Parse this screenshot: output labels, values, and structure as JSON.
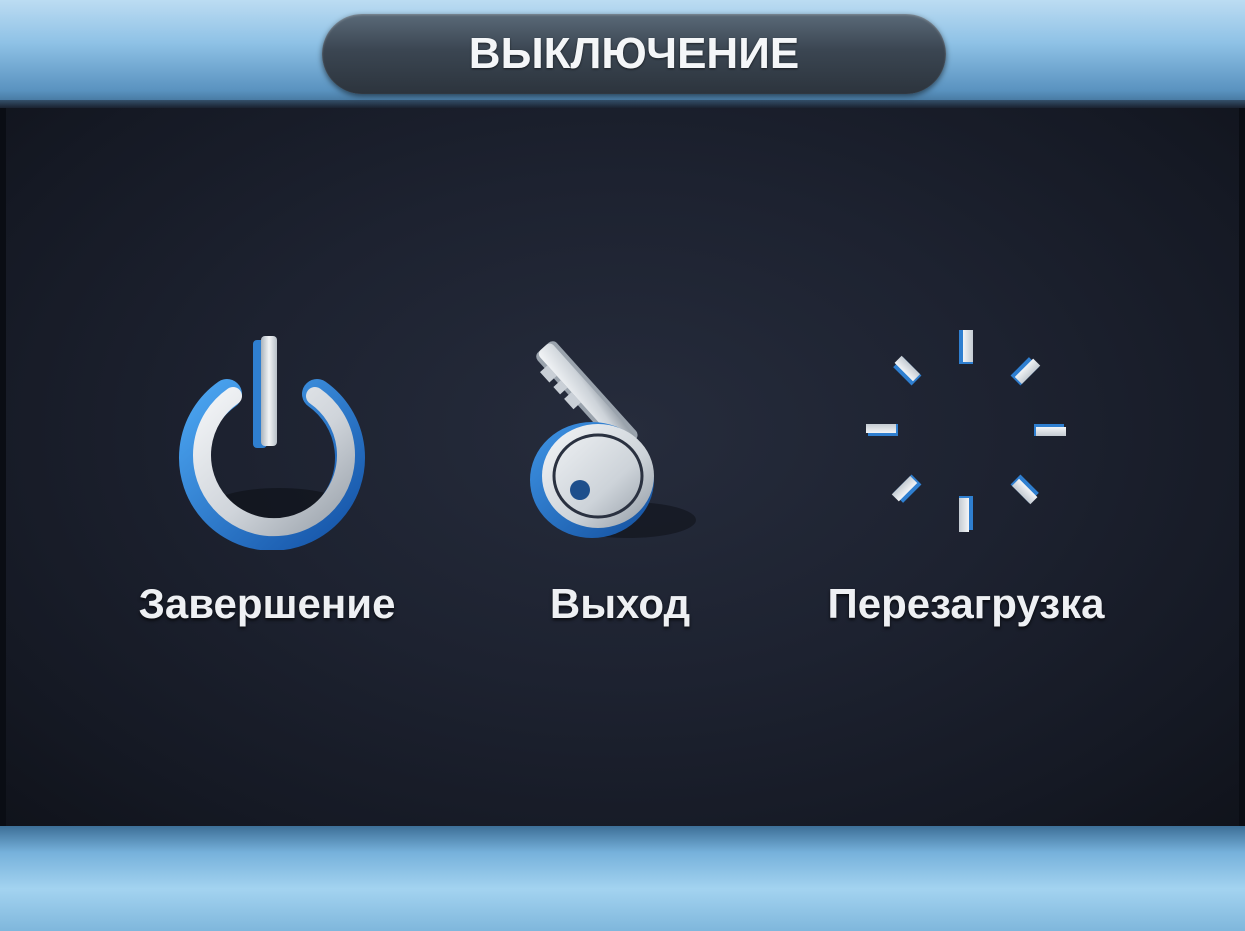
{
  "dialog": {
    "title": "ВЫКЛЮЧЕНИЕ"
  },
  "options": [
    {
      "label": "Завершение",
      "icon": "power-icon"
    },
    {
      "label": "Выход",
      "icon": "key-icon"
    },
    {
      "label": "Перезагрузка",
      "icon": "restart-spinner-icon"
    }
  ],
  "colors": {
    "accent_blue": "#2f7fd0",
    "icon_silver": "#d9dde2",
    "panel_bg": "#1d2230",
    "frame_blue": "#8fc2e6"
  }
}
